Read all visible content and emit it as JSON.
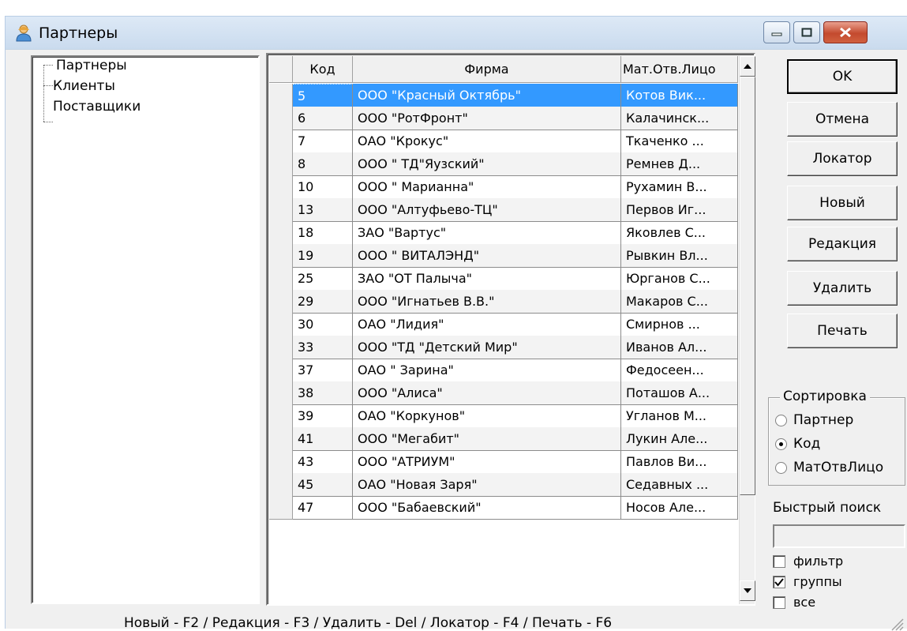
{
  "window": {
    "title": "Партнеры"
  },
  "tree": {
    "items": [
      {
        "label": "Партнеры"
      },
      {
        "label": "Клиенты"
      },
      {
        "label": "Поставщики"
      }
    ]
  },
  "grid": {
    "columns": [
      {
        "label": "Код"
      },
      {
        "label": "Фирма"
      },
      {
        "label": "Мат.Отв.Лицо"
      }
    ],
    "rows": [
      {
        "code": "5",
        "firm": "ООО \"Красный Октябрь\"",
        "person": "Котов Вик...",
        "selected": true
      },
      {
        "code": "6",
        "firm": "ООО \"РотФронт\"",
        "person": "Калачинск..."
      },
      {
        "code": "7",
        "firm": "ОАО \"Крокус\"",
        "person": "Ткаченко ..."
      },
      {
        "code": "8",
        "firm": "ООО \" ТД\"Яузский\"",
        "person": "Ремнев Д..."
      },
      {
        "code": "10",
        "firm": "ООО \" Марианна\"",
        "person": "Рухамин В..."
      },
      {
        "code": "13",
        "firm": "ООО \"Алтуфьево-ТЦ\"",
        "person": "Первов Иг..."
      },
      {
        "code": "18",
        "firm": "ЗАО \"Вартус\"",
        "person": "Яковлев С..."
      },
      {
        "code": "19",
        "firm": "ООО \" ВИТАЛЭНД\"",
        "person": "Рывкин Вл..."
      },
      {
        "code": "25",
        "firm": "ЗАО \"ОТ Палыча\"",
        "person": "Юрганов С..."
      },
      {
        "code": "29",
        "firm": "ООО \"Игнатьев В.В.\"",
        "person": "Макаров С..."
      },
      {
        "code": "30",
        "firm": "ОАО \"Лидия\"",
        "person": "Смирнов ..."
      },
      {
        "code": "33",
        "firm": "ООО \"ТД \"Детский Мир\"",
        "person": "Иванов Ал..."
      },
      {
        "code": "37",
        "firm": "ОАО \" Зарина\"",
        "person": "Федосеен..."
      },
      {
        "code": "38",
        "firm": "ООО \"Алиса\"",
        "person": "Поташов А..."
      },
      {
        "code": "39",
        "firm": "ОАО \"Коркунов\"",
        "person": "Угланов М..."
      },
      {
        "code": "41",
        "firm": "ООО \"Мегабит\"",
        "person": "Лукин Але..."
      },
      {
        "code": "43",
        "firm": "ООО \"АТРИУМ\"",
        "person": "Павлов Ви..."
      },
      {
        "code": "45",
        "firm": "ОАО \"Новая Заря\"",
        "person": "Седавных ..."
      },
      {
        "code": "47",
        "firm": "ООО \"Бабаевский\"",
        "person": "Носов Але..."
      }
    ]
  },
  "buttons": {
    "ok": "OK",
    "cancel": "Отмена",
    "locator": "Локатор",
    "new": "Новый",
    "edit": "Редакция",
    "delete": "Удалить",
    "print": "Печать"
  },
  "sort": {
    "title": "Сортировка",
    "options": [
      {
        "label": "Партнер",
        "checked": false
      },
      {
        "label": "Код",
        "checked": true
      },
      {
        "label": "МатОтвЛицо",
        "checked": false
      }
    ]
  },
  "quick_search": {
    "label": "Быстрый поиск",
    "value": ""
  },
  "checkboxes": [
    {
      "label": "фильтр",
      "checked": false
    },
    {
      "label": "группы",
      "checked": true
    },
    {
      "label": "все",
      "checked": false
    }
  ],
  "status_bar": "Новый - F2 / Редакция - F3 / Удалить - Del / Локатор - F4 / Печать - F6",
  "colors": {
    "selection": "#3399ff",
    "titlebar": "#cadbee",
    "close_button": "#c44a2e"
  }
}
